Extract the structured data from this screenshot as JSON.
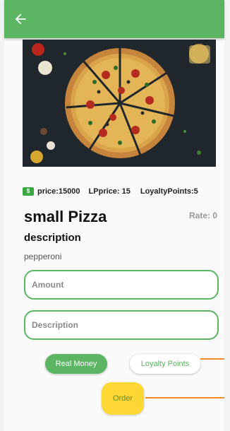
{
  "header": {
    "back_icon": "arrow-left-icon",
    "bar_color": "#5cb563"
  },
  "hero": {
    "image_description": "pizza"
  },
  "price_info": {
    "currency_icon": "money-icon",
    "price": "price:15000",
    "lp_price": "LPprice: 15",
    "loyalty_points": "LoyaltyPoints:5"
  },
  "product": {
    "title": "small Pizza",
    "rate": "Rate: 0",
    "description_heading": "description",
    "description_value": "pepperoni"
  },
  "form": {
    "amount_placeholder": "Amount",
    "description_placeholder": "Description"
  },
  "payment": {
    "real_money_label": "Real Money",
    "loyalty_points_label": "Loyalty Points"
  },
  "order": {
    "label": "Order"
  },
  "colors": {
    "accent": "#5cb563",
    "order_button": "#fdd835",
    "connector": "#f08a24"
  }
}
